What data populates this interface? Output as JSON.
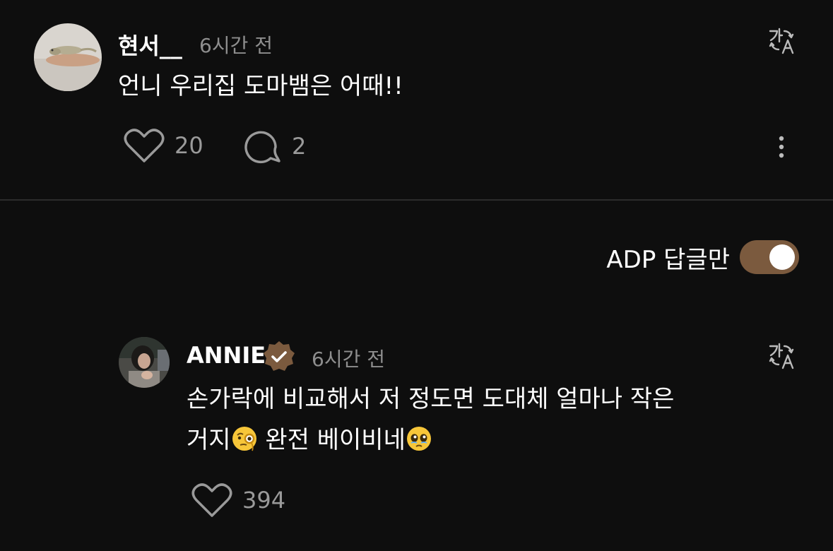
{
  "comment": {
    "username": "현서__",
    "timestamp": "6시간 전",
    "text": "언니 우리집 도마뱀은 어때!!",
    "likes": "20",
    "replies": "2",
    "avatar_icon": "lizard-photo-avatar"
  },
  "filter": {
    "label": "ADP 답글만",
    "enabled": true,
    "accent_color": "#7b5a3e"
  },
  "reply": {
    "username": "ANNIE",
    "verified": true,
    "timestamp": "6시간 전",
    "line1": "손가락에 비교해서 저 정도면 도대체 얼마나 작은",
    "line2a": "거지",
    "line2b": " 완전 베이비네",
    "emoji1": "face-with-monocle",
    "emoji2": "pleading-face",
    "likes": "394",
    "avatar_icon": "person-photo-avatar"
  },
  "icons": {
    "translate": "translate-icon",
    "heart": "heart-icon",
    "comment": "comment-bubble-icon",
    "more": "more-vertical-icon"
  }
}
